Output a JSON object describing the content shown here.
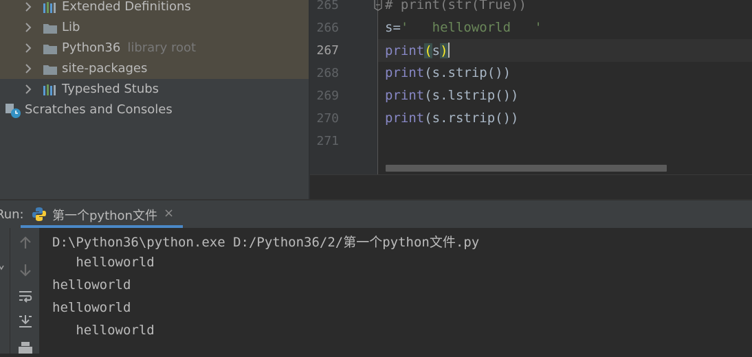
{
  "project_tree": {
    "items": [
      {
        "label": "Extended Definitions",
        "hint": "",
        "icon": "library-icon"
      },
      {
        "label": "Lib",
        "hint": "",
        "icon": "folder-icon"
      },
      {
        "label": "Python36",
        "hint": "library root",
        "icon": "folder-icon"
      },
      {
        "label": "site-packages",
        "hint": "",
        "icon": "folder-icon"
      },
      {
        "label": "Typeshed Stubs",
        "hint": "",
        "icon": "library-icon"
      }
    ],
    "scratches_label": "Scratches and Consoles"
  },
  "editor": {
    "line_numbers": [
      "265",
      "266",
      "267",
      "268",
      "269",
      "270",
      "271"
    ],
    "current_line": "267",
    "lines": {
      "l265_comment": "# print(str(True))",
      "l266_var": "s=",
      "l266_str": "'   helloworld   '",
      "l267_fn": "print",
      "l267_open": "(",
      "l267_arg": "s",
      "l267_close": ")",
      "l268_fn": "print",
      "l268_rest": "(s.strip())",
      "l269_fn": "print",
      "l269_rest": "(s.lstrip())",
      "l270_fn": "print",
      "l270_rest": "(s.rstrip())"
    }
  },
  "run": {
    "label": "Run:",
    "tab_label": "第一个python文件",
    "tab_close": "×",
    "output": [
      "D:\\Python36\\python.exe D:/Python36/2/第一个python文件.py",
      "   helloworld",
      "helloworld",
      "helloworld",
      "   helloworld"
    ]
  },
  "colors": {
    "accent": "#4a88c7",
    "keyword_print": "#8888c6",
    "string": "#6a8759",
    "comment": "#808080"
  }
}
